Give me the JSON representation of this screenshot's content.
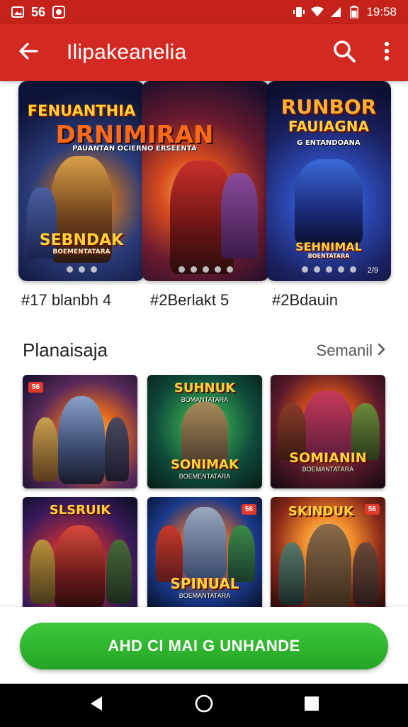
{
  "status_bar": {
    "left_text": "56",
    "time": "19:58"
  },
  "app_bar": {
    "title": "Ilipakeanelia",
    "back_icon": "arrow-back-icon",
    "search_icon": "search-icon",
    "more_icon": "more-vert-icon"
  },
  "featured": {
    "cards": [
      {
        "title": "FENUANTHIA",
        "subtitle": "DRNIMIRAN",
        "tagline": "PAUANTAN OCIERNO ERSEENTA",
        "badge": "SEBNDAK",
        "badge_sub": "BOEMENTATARA",
        "price": "#17 blanbh 4"
      },
      {
        "title": "",
        "subtitle": "",
        "tagline": "",
        "badge": "",
        "badge_sub": "",
        "price": "#2Berlakt 5"
      },
      {
        "title": "RUNBOR",
        "subtitle": "FAUIAGNA",
        "tagline": "G ENTANDOANA",
        "badge": "SEHNIMAL",
        "badge_sub": "BOENTATARA",
        "price": "#2Bdauin",
        "counter": "2/9"
      }
    ]
  },
  "section": {
    "title": "Planaisaja",
    "see_all": "Semanil"
  },
  "grid": {
    "tiles": [
      {
        "tag": "56",
        "title": "",
        "sub": ""
      },
      {
        "tag": "",
        "title": "SUHNUK",
        "sub": "BOMANTATARA",
        "title_bottom": "SONIMAK",
        "sub_bottom": "BOEMENTATARA"
      },
      {
        "tag": "",
        "title": "",
        "sub": "",
        "title_bottom": "SOMIANIN",
        "sub_bottom": "BOEMANTATARA"
      },
      {
        "tag": "",
        "title": "SLSRUIK",
        "sub": ""
      },
      {
        "tag": "56",
        "title": "",
        "sub": "",
        "title_bottom": "SPINUAL",
        "sub_bottom": "BOEMANTATARA"
      },
      {
        "tag": "56",
        "title": "SKINDUK",
        "sub": ""
      }
    ]
  },
  "cta": {
    "label": "AHD CI MAI G UNHANDE"
  },
  "nav": {
    "back_icon": "nav-back-icon",
    "home_icon": "nav-home-icon",
    "recents_icon": "nav-recents-icon"
  },
  "colors": {
    "status_bar": "#c4221b",
    "app_bar": "#d22a22",
    "cta": "#2eb52e",
    "nav": "#000000"
  }
}
